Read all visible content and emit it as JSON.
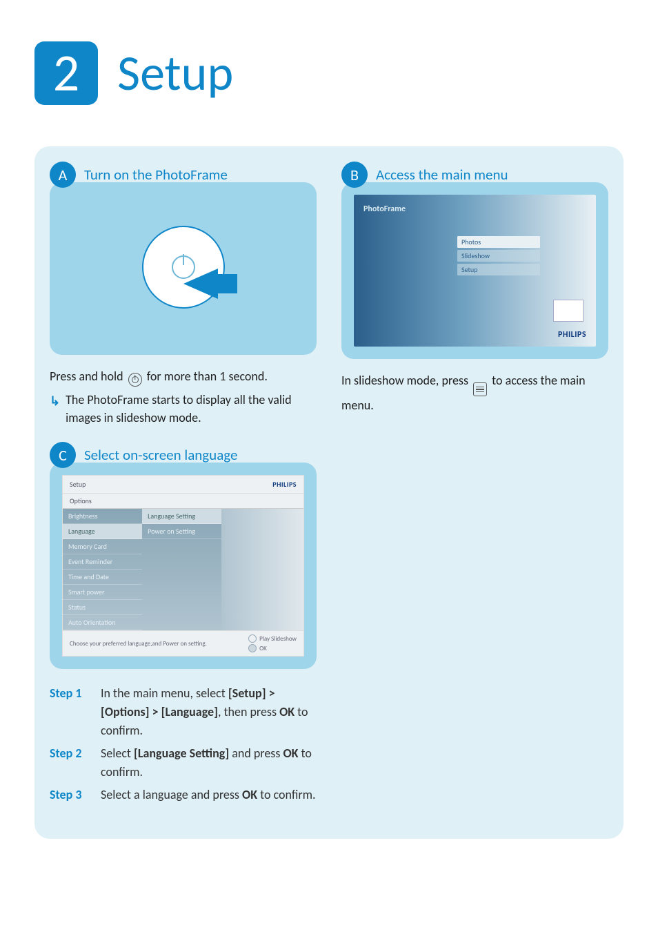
{
  "header": {
    "number": "2",
    "title": "Setup"
  },
  "a": {
    "letter": "A",
    "title": "Turn on the PhotoFrame",
    "instruction_pre": "Press and hold ",
    "instruction_post": " for more than 1 second.",
    "sub": "The PhotoFrame starts to display all the valid images in slideshow mode."
  },
  "b": {
    "letter": "B",
    "title": "Access the main menu",
    "screen": {
      "label": "PhotoFrame",
      "items": [
        "Photos",
        "Slideshow",
        "Setup"
      ],
      "brand": "PHILIPS"
    },
    "instruction_pre": "In slideshow mode, press ",
    "instruction_post": " to  access the main menu."
  },
  "c": {
    "letter": "C",
    "title": "Select on-screen language",
    "screen": {
      "header": "Setup",
      "brand": "PHILIPS",
      "options_label": "Options",
      "col1": [
        "Brightness",
        "Language",
        "Memory Card",
        "Event Reminder",
        "Time and Date",
        "Smart power",
        "Status",
        "Auto Orientation"
      ],
      "col1_selected_index": 1,
      "col2": [
        "Language Setting",
        "Power on Setting"
      ],
      "col2_selected_index": 0,
      "footer_hint": "Choose your preferred language,and Power on setting.",
      "footer_right": [
        "Play Slideshow",
        "OK"
      ]
    },
    "steps": [
      {
        "label": "Step 1",
        "pre": "In the main menu, select ",
        "bold1": "[Setup] > [Options] > [Language]",
        "mid": ", then press ",
        "bold2": "OK",
        "post": " to confirm."
      },
      {
        "label": "Step 2",
        "pre": "Select ",
        "bold1": "[Language Setting]",
        "mid": " and press ",
        "bold2": "OK",
        "post": " to confirm."
      },
      {
        "label": "Step 3",
        "pre": "Select a language and press ",
        "bold1": "OK",
        "mid": "",
        "bold2": "",
        "post": " to confirm."
      }
    ]
  }
}
